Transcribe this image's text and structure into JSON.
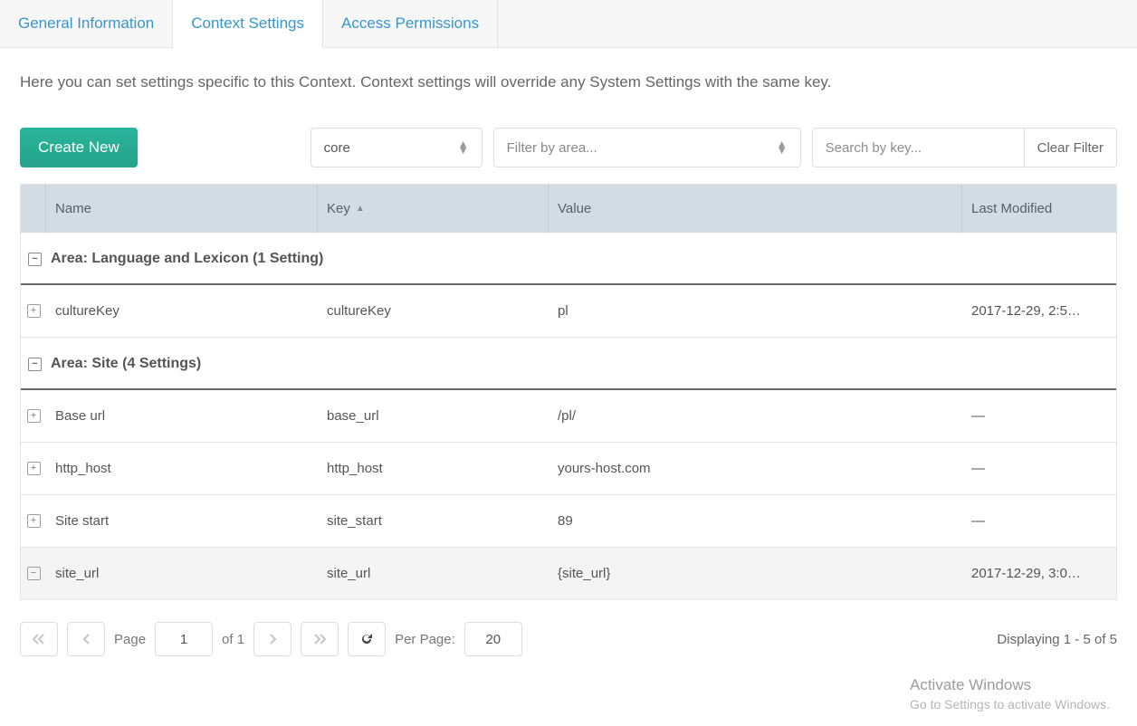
{
  "tabs": {
    "general": "General Information",
    "context": "Context Settings",
    "permissions": "Access Permissions",
    "active": "context"
  },
  "description": "Here you can set settings specific to this Context. Context settings will override any System Settings with the same key.",
  "toolbar": {
    "create_label": "Create New",
    "namespace_value": "core",
    "area_placeholder": "Filter by area...",
    "search_placeholder": "Search by key...",
    "clear_label": "Clear Filter"
  },
  "columns": {
    "name": "Name",
    "key": "Key",
    "value": "Value",
    "modified": "Last Modified",
    "sort": "key",
    "sort_dir": "asc"
  },
  "groups": [
    {
      "label": "Area: Language and Lexicon (1 Setting)",
      "expanded": true,
      "rows": [
        {
          "expanded": false,
          "name": "cultureKey",
          "key": "cultureKey",
          "value": "pl",
          "modified": "2017-12-29, 2:5…"
        }
      ]
    },
    {
      "label": "Area: Site (4 Settings)",
      "expanded": true,
      "rows": [
        {
          "expanded": false,
          "name": "Base url",
          "key": "base_url",
          "value": "/pl/",
          "modified": "—"
        },
        {
          "expanded": false,
          "name": "http_host",
          "key": "http_host",
          "value": "yours-host.com",
          "modified": "—"
        },
        {
          "expanded": false,
          "name": "Site start",
          "key": "site_start",
          "value": "89",
          "modified": "—"
        },
        {
          "expanded": true,
          "name": "site_url",
          "key": "site_url",
          "value": "{site_url}",
          "modified": "2017-12-29, 3:0…"
        }
      ]
    }
  ],
  "pager": {
    "page_label": "Page",
    "page_value": "1",
    "of_label": "of 1",
    "per_page_label": "Per Page:",
    "per_page_value": "20",
    "display_text": "Displaying 1 - 5 of 5"
  },
  "watermark": {
    "line1": "Activate Windows",
    "line2": "Go to Settings to activate Windows."
  }
}
